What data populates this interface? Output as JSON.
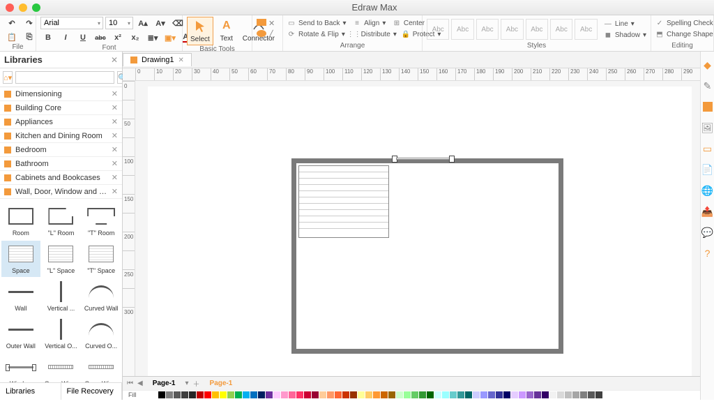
{
  "app": {
    "title": "Edraw Max"
  },
  "ribbon": {
    "file_label": "File",
    "font": {
      "label": "Font",
      "family": "Arial",
      "size": "10",
      "bold": "B",
      "italic": "I",
      "underline": "U",
      "strike": "abc"
    },
    "basic_tools": {
      "label": "Basic Tools",
      "select": "Select",
      "text": "Text",
      "connector": "Connector"
    },
    "arrange": {
      "label": "Arrange",
      "send_to_back": "Send to Back",
      "align": "Align",
      "center": "Center",
      "rotate_flip": "Rotate & Flip",
      "distribute": "Distribute",
      "protect": "Protect"
    },
    "styles": {
      "label": "Styles",
      "sample": "Abc",
      "line": "Line",
      "shadow": "Shadow"
    },
    "editing": {
      "label": "Editing",
      "spelling": "Spelling Check",
      "change_shape": "Change Shape"
    }
  },
  "libraries": {
    "title": "Libraries",
    "search_placeholder": "",
    "categories": [
      "Dimensioning",
      "Building Core",
      "Appliances",
      "Kitchen and Dining Room",
      "Bedroom",
      "Bathroom",
      "Cabinets and Bookcases",
      "Wall, Door, Window and Structure"
    ],
    "shapes": [
      "Room",
      "\"L\" Room",
      "\"T\" Room",
      "Space",
      "\"L\" Space",
      "\"T\" Space",
      "Wall",
      "Vertical ...",
      "Curved Wall",
      "Outer Wall",
      "Vertical O...",
      "Curved O...",
      "Window",
      "Open Win...",
      "Open Win..."
    ],
    "footer": {
      "libraries": "Libraries",
      "recovery": "File Recovery"
    }
  },
  "document": {
    "tab": "Drawing1",
    "page_tab": "Page-1",
    "page_tab2": "Page-1"
  },
  "ruler": {
    "h": [
      "0",
      "10",
      "20",
      "30",
      "40",
      "50",
      "60",
      "70",
      "80",
      "90",
      "100",
      "110",
      "120",
      "130",
      "140",
      "150",
      "160",
      "170",
      "180",
      "190",
      "200",
      "210",
      "220",
      "230",
      "240",
      "250",
      "260",
      "270",
      "280",
      "290"
    ],
    "v": [
      "0",
      "",
      "50",
      "",
      "100",
      "",
      "150",
      "",
      "200",
      "",
      "250",
      "",
      "300"
    ]
  },
  "colors": [
    "#fff",
    "#000",
    "#7f7f7f",
    "#595959",
    "#3f3f3f",
    "#262626",
    "#c00000",
    "#ff0000",
    "#ffc000",
    "#ffff00",
    "#92d050",
    "#00b050",
    "#00b0f0",
    "#0070c0",
    "#002060",
    "#7030a0",
    "#ffccff",
    "#ff99cc",
    "#ff6699",
    "#ff3366",
    "#cc0033",
    "#990033",
    "#ffcc99",
    "#ff9966",
    "#ff6633",
    "#cc3300",
    "#993300",
    "#ffff99",
    "#ffcc66",
    "#ff9933",
    "#cc6600",
    "#996600",
    "#ccffcc",
    "#99ff99",
    "#66cc66",
    "#339933",
    "#006600",
    "#ccffff",
    "#99ffff",
    "#66cccc",
    "#339999",
    "#006666",
    "#ccccff",
    "#9999ff",
    "#6666cc",
    "#333399",
    "#000066",
    "#e5ccff",
    "#cc99ff",
    "#9966cc",
    "#663399",
    "#330066",
    "#f2f2f2",
    "#d9d9d9",
    "#bfbfbf",
    "#a6a6a6",
    "#808080",
    "#595959",
    "#404040"
  ]
}
